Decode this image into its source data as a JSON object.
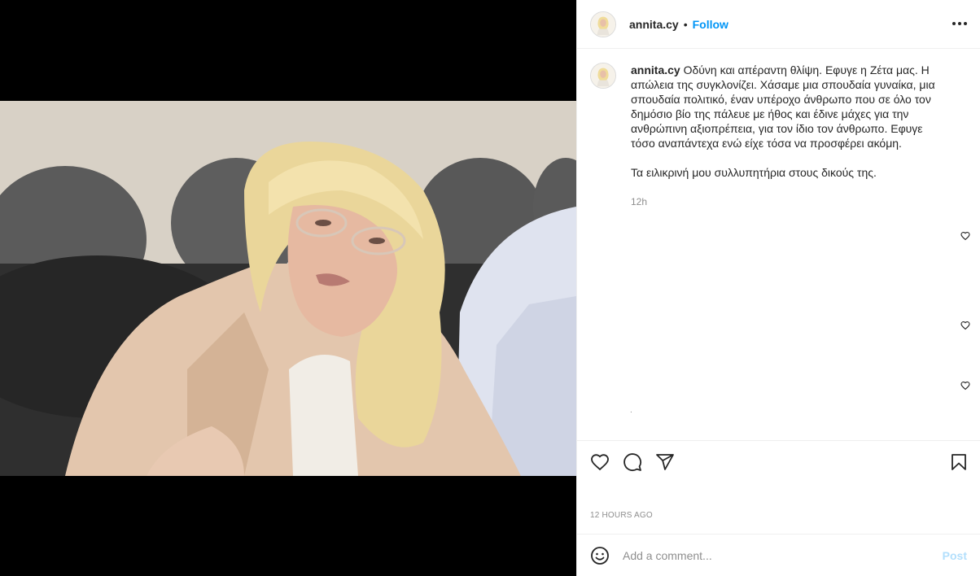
{
  "post": {
    "username": "annita.cy",
    "follow_label": "Follow",
    "separator": "•",
    "caption_lines": [
      "Οδύνη και απέραντη θλίψη. Εφυγε η Ζέτα μας. Η απώλεια της συγκλονίζει. Χάσαμε μια σπουδαία γυναίκα, μια σπουδαία πολιτικό, έναν υπέροχο άνθρωπο που σε όλο τον δημόσιο βίο της πάλευε με ήθος και έδινε μάχες για την ανθρώπινη αξιοπρέπεια, για τον ίδιο τον άνθρωπο. Εφυγε τόσο αναπάντεχα ενώ είχε τόσα να προσφέρει ακόμη.",
      "Τα ειλικρινή μου συλλυπητήρια στους δικούς της."
    ],
    "caption_time": "12h",
    "trailing_dot": ".",
    "posted_ago": "12 HOURS AGO"
  },
  "comment_box": {
    "placeholder": "Add a comment...",
    "post_label": "Post"
  },
  "icons": {
    "more": "more-options-icon",
    "like": "heart-icon",
    "comment": "comment-icon",
    "share": "share-icon",
    "save": "bookmark-icon",
    "emoji": "emoji-icon"
  },
  "colors": {
    "accent": "#0095f6",
    "post_disabled": "#b2dffc",
    "muted": "#8e8e8e",
    "text": "#262626"
  }
}
